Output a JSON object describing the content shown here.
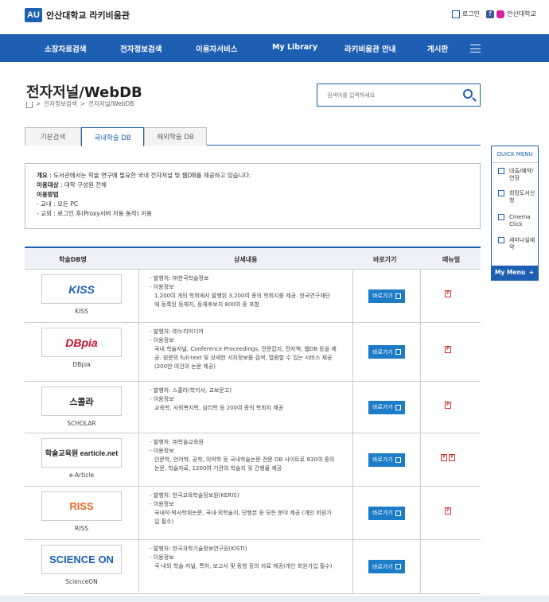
{
  "header": {
    "logo_mark": "AU",
    "logo_text": "안산대학교 라키비움관",
    "login": "로그인",
    "univ": "안산대학교",
    "fb": "f"
  },
  "nav": [
    "소장자료검색",
    "전자정보검색",
    "이용자서비스",
    "My Library",
    "라키비움관 안내",
    "게시판"
  ],
  "page": {
    "title": "전자저널/WebDB",
    "crumb1": "전자정보검색",
    "crumb2": "전자저널/WebDB",
    "search_placeholder": "검색어를 입력하세요"
  },
  "tabs": [
    "기본검색",
    "국내학술 DB",
    "해외학술 DB"
  ],
  "info": {
    "l1a": "개요",
    "l1b": " : 도서관에서는 학술 연구에 필요한 국내 전자저널 및 웹DB를 제공하고 있습니다.",
    "l2a": "이용대상",
    "l2b": " : 대학 구성원 전체",
    "l3": "이용방법",
    "l4": "- 교내 : 모든 PC",
    "l5": "- 교외 : 로그인 후(Proxy서버 자동 동작) 이용"
  },
  "table": {
    "headers": [
      "학술DB명",
      "상세내용",
      "바로가기",
      "매뉴얼"
    ],
    "go_label": "바로가기",
    "rows": [
      {
        "logo": "KISS",
        "name": "KISS",
        "d": [
          "- 발행처: ㈜한국학술정보",
          "- 이용정보",
          "1,200여 개의 학회에서 발행된 3,200여 종의 학회지를 제공. 한국연구재단",
          "에 등록된 등재지, 등재후보지 800여 종 포함"
        ]
      },
      {
        "logo": "DBpia",
        "name": "DBpia",
        "d": [
          "- 발행처: ㈜누리미디어",
          "- 이용정보",
          "국내 학술저널, Conference Proceedings, 전문잡지, 전자책, 웹DB 등을 제",
          "공. 원문의 full-text 및 상세한 서지정보를 검색, 열람할 수 있는 서비스 제공",
          "(200만 여건의 논문 제공)"
        ]
      },
      {
        "logo": "스콜라",
        "name": "SCHOLAR",
        "d": [
          "- 발행처: 스콜라(학지사, 교보문고)",
          "- 이용정보",
          "교육학, 사회복지학, 심리학 등 200여 종의 학회지 제공"
        ]
      },
      {
        "logo": "학술교육원 earticle.net",
        "name": "e-Article",
        "d": [
          "- 발행처: ㈜학술교육원",
          "- 이용정보",
          "인문학, 언어학, 공학, 의약학 등 국내학술논문 전문 DB 사이트로 830여 종의",
          "논문, 학술자료, 1200여 기관의 학술지 및 간행물 제공"
        ]
      },
      {
        "logo": "RISS",
        "name": "RISS",
        "d": [
          "- 발행처: 한국교육학술정보원(KERIS)",
          "- 이용정보",
          "국내석·박사학위논문, 국내·외학술지, 단행본 등 모든 분야 제공 (개인 회원가",
          "입 필수)"
        ]
      },
      {
        "logo": "SCIENCE ON",
        "name": "ScienceON",
        "d": [
          "- 발행처: 한국과학기술정보연구원(KISTI)",
          "- 이용정보",
          "국·내외 학술 저널, 특허, 보고서 및 동향 등의 자료 제공(개인 회원가입 필수)"
        ]
      }
    ]
  },
  "quick": {
    "title": "QUICK MENU",
    "items": [
      "대출/예약/연장",
      "희망도서신청",
      "Cinema Click",
      "세미나실예약"
    ],
    "my": "My Menu",
    "plus": "+"
  },
  "colors": {
    "brand": "#1e5fb4",
    "button": "#1d7cc8"
  }
}
